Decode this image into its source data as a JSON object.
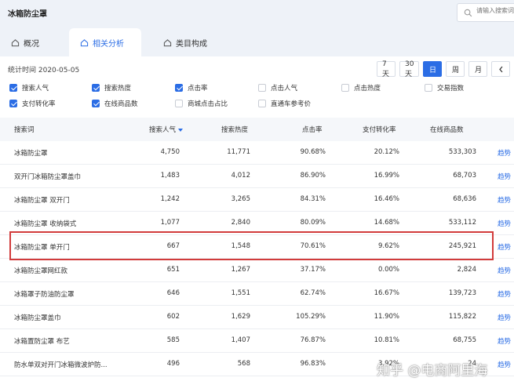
{
  "page": {
    "title": "冰箱防尘罩"
  },
  "search": {
    "placeholder": "请输入搜索词"
  },
  "tabs": [
    {
      "label": "概况",
      "icon": "home-icon"
    },
    {
      "label": "相关分析",
      "icon": "home-icon"
    },
    {
      "label": "类目构成",
      "icon": "home-icon"
    }
  ],
  "stat": {
    "text": "统计时间 2020-05-05"
  },
  "day_buttons": [
    "7天",
    "30天",
    "日",
    "周",
    "月"
  ],
  "filters": [
    {
      "label": "搜索人气",
      "checked": true
    },
    {
      "label": "搜索热度",
      "checked": true
    },
    {
      "label": "点击率",
      "checked": true
    },
    {
      "label": "点击人气",
      "checked": false
    },
    {
      "label": "点击热度",
      "checked": false
    },
    {
      "label": "交易指数",
      "checked": false
    },
    {
      "label": "支付转化率",
      "checked": true
    },
    {
      "label": "在线商品数",
      "checked": true
    },
    {
      "label": "商城点击占比",
      "checked": false
    },
    {
      "label": "直通车参考价",
      "checked": false
    }
  ],
  "table": {
    "headers": [
      "搜索词",
      "搜索人气",
      "搜索热度",
      "点击率",
      "支付转化率",
      "在线商品数",
      ""
    ],
    "rows": [
      [
        "冰箱防尘罩",
        "4,750",
        "11,771",
        "90.68%",
        "20.12%",
        "533,303",
        "趋势"
      ],
      [
        "双开门冰箱防尘罩盖巾",
        "1,483",
        "4,012",
        "86.90%",
        "16.99%",
        "68,703",
        "趋势"
      ],
      [
        "冰箱防尘罩 双开门",
        "1,242",
        "3,265",
        "84.31%",
        "16.46%",
        "68,636",
        "趋势"
      ],
      [
        "冰箱防尘罩 收纳袋式",
        "1,077",
        "2,840",
        "80.09%",
        "14.68%",
        "533,112",
        "趋势"
      ],
      [
        "冰箱防尘罩 单开门",
        "667",
        "1,548",
        "70.61%",
        "9.62%",
        "245,921",
        "趋势"
      ],
      [
        "冰箱防尘罩网红款",
        "651",
        "1,267",
        "37.17%",
        "0.00%",
        "2,824",
        "趋势"
      ],
      [
        "冰箱罩子防油防尘罩",
        "646",
        "1,551",
        "62.74%",
        "16.67%",
        "139,723",
        "趋势"
      ],
      [
        "冰箱防尘罩盖巾",
        "602",
        "1,629",
        "105.29%",
        "11.90%",
        "115,822",
        "趋势"
      ],
      [
        "冰箱置防尘罩 布艺",
        "585",
        "1,407",
        "76.87%",
        "10.81%",
        "68,755",
        "趋势"
      ],
      [
        "防水单双对开门冰箱微波炉防...",
        "496",
        "568",
        "96.83%",
        "3.92%",
        "24",
        "趋势"
      ]
    ]
  },
  "watermark": {
    "text": "知乎 @电商阿里海"
  },
  "colors": {
    "accent": "#2b6de5",
    "highlight": "#d23b3b"
  }
}
